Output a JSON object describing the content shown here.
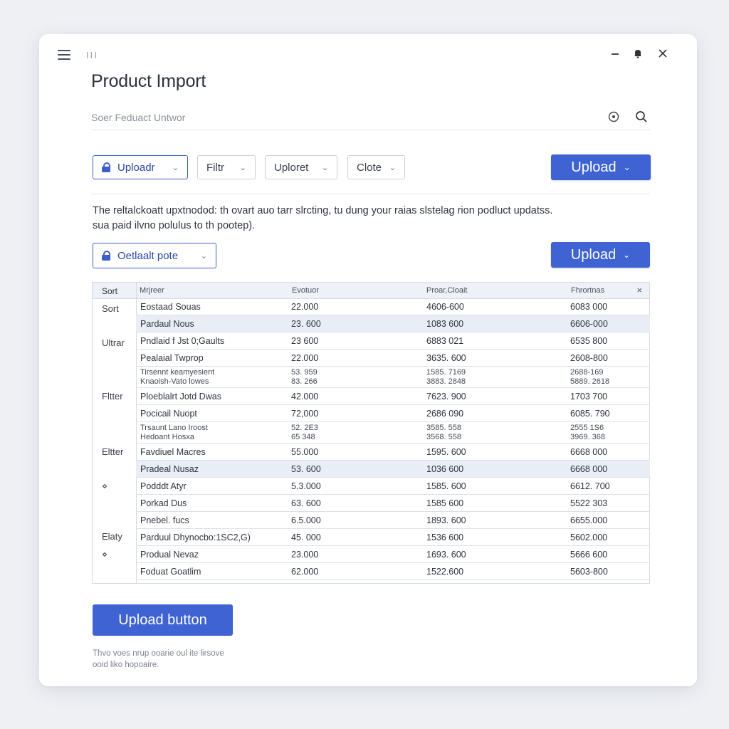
{
  "window": {
    "title": "Product Import",
    "ticks": "III"
  },
  "search": {
    "placeholder": "Soer Feduact Untwor"
  },
  "toolbar": {
    "upload_dropdown": "Uploadr",
    "filter_dropdown": "Filtr",
    "uploret_dropdown": "Uploret",
    "clote_dropdown": "Clote",
    "upload_primary": "Upload"
  },
  "description": {
    "line1": "The reltalckoatt upxtnodod: th ovart auo tarr slrcting, tu dung your raias slstelag rion podluct updatss.",
    "line2": "sua paid ilvno polulus to th pootep)."
  },
  "secondary": {
    "default_dropdown": "Oetlaalt pote",
    "upload_primary": "Upload"
  },
  "table": {
    "headers": {
      "sort": "Sort",
      "col1": "Mrjreer",
      "col2": "Evotuor",
      "col3": "Proar,Cloait",
      "col4": "Fhrortnas"
    },
    "sidebar": [
      "Sort",
      "Ultrar",
      "Fltter",
      "Eltter",
      "⋄",
      "Elaty",
      "⋄"
    ],
    "rows": [
      {
        "name": "Eostaad Souas",
        "v1": "22.000",
        "v2": "4606-600",
        "v3": "6083 000"
      },
      {
        "name": "Pardaul Nous",
        "v1": "23. 600",
        "v2": "1083 600",
        "v3": "6606-000"
      },
      {
        "name": "Pndlaid f Jst 0;Gaults",
        "v1": "23 600",
        "v2": "6883 021",
        "v3": "6535 800"
      },
      {
        "name": "Pealaial Twprop",
        "v1": "22.000",
        "v2": "3635. 600",
        "v3": "2608-800"
      },
      {
        "name": "Tirsennt keamyesient",
        "name2": "Knaoish-Vato lowes",
        "v1": "53. 959",
        "v1b": "83. 266",
        "v2": "1585. 7169",
        "v2b": "3883. 2848",
        "v3": "2688-169",
        "v3b": "5889. 2618"
      },
      {
        "name": "Ploeblalrt Jotd Dwas",
        "v1": "42.000",
        "v2": "7623. 900",
        "v3": "1703 700"
      },
      {
        "name": "Pocicail Nuopt",
        "v1": "72,000",
        "v2": "2686 090",
        "v3": "6085. 790"
      },
      {
        "name": "Trsaunt Lano Iroost",
        "name2": "Hedoant Hosxa",
        "v1": "52. 2E3",
        "v1b": "65 348",
        "v2": "3585. 558",
        "v2b": "3568. 558",
        "v3": "2555 1S6",
        "v3b": "3969. 368"
      },
      {
        "name": "Favdiuel Macres",
        "v1": "55.000",
        "v2": "1595. 600",
        "v3": "6668 000"
      },
      {
        "name": "Pradeal Nusaz",
        "v1": "53. 600",
        "v2": "1036 600",
        "v3": "6668 000"
      },
      {
        "name": "Podddt Atyr",
        "v1": "5.3.000",
        "v2": "1585. 600",
        "v3": "6612. 700"
      },
      {
        "name": "Porkad Dus",
        "v1": "63. 600",
        "v2": "1585 600",
        "v3": "5522 303"
      },
      {
        "name": "Pnebel. fucs",
        "v1": "6.5.000",
        "v2": "1893. 600",
        "v3": "6655.000"
      },
      {
        "name": "Parduul Dhynocbo:1SC2,G)",
        "v1": "45. 000",
        "v2": "1536 600",
        "v3": "5602.000"
      },
      {
        "name": "Produal Nevaz",
        "v1": "23.000",
        "v2": "1693. 600",
        "v3": "5666 600"
      },
      {
        "name": "Foduat Goatlim",
        "v1": "62.000",
        "v2": "1522.600",
        "v3": "5603-800"
      }
    ]
  },
  "footer": {
    "upload_button": "Upload button",
    "note_line1": "Thvo voes nrup ooarie oul ite lirsove",
    "note_line2": "ooid liko hopoaire."
  },
  "colors": {
    "accent": "#3f63d2",
    "row_alt": "#e9edf6"
  }
}
